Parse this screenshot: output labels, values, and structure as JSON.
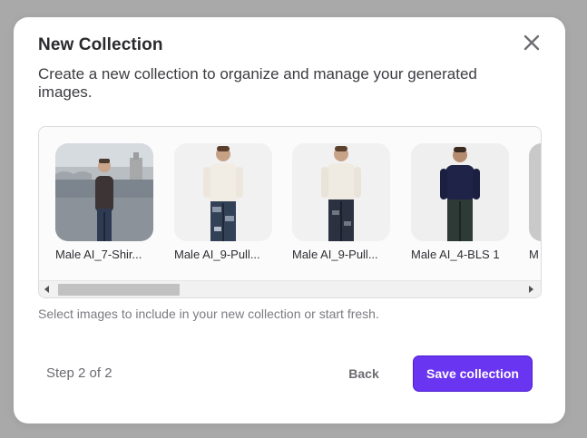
{
  "modal": {
    "title": "New Collection",
    "subtitle": "Create a new collection to organize and manage your generated images.",
    "helper_text": "Select images to include in your new collection or start fresh.",
    "step_text": "Step 2 of 2",
    "back_label": "Back",
    "save_label": "Save collection"
  },
  "gallery": {
    "items": [
      {
        "label": "Male AI_7-Shir...",
        "icon": "photo-man-dark-sweater-riverside"
      },
      {
        "label": "Male AI_9-Pull...",
        "icon": "photo-man-white-sweater-camo-jeans"
      },
      {
        "label": "Male AI_9-Pull...",
        "icon": "photo-man-white-sweater-jeans"
      },
      {
        "label": "Male AI_4-BLS 1",
        "icon": "photo-man-navy-sweater"
      },
      {
        "label": "M",
        "icon": "photo-partial"
      }
    ]
  },
  "colors": {
    "accent": "#6a35f0",
    "backdrop": "#a9a9a9"
  }
}
